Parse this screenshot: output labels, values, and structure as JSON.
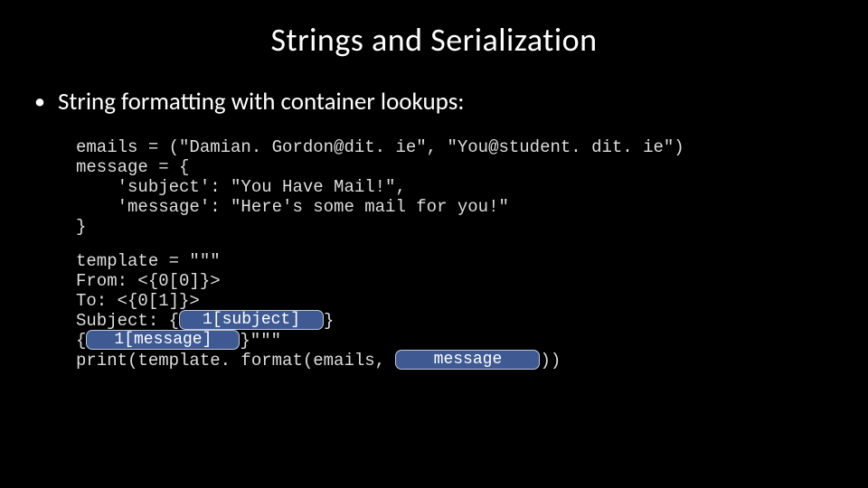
{
  "title": "Strings and Serialization",
  "bullet": "String formatting with container lookups:",
  "code_block1": "emails = (\"Damian. Gordon@dit. ie\", \"You@student. dit. ie\")\nmessage = {\n    'subject': \"You Have Mail!\",\n    'message': \"Here's some mail for you!\"\n}",
  "code2": {
    "l1": "template = \"\"\"",
    "l2": "From: <{0[0]}>",
    "l3": "To: <{0[1]}>",
    "l4_a": "Subject: {",
    "l4_pill": "1[subject]",
    "l4_b": "}",
    "l5_a": "{",
    "l5_pill": "1[message]",
    "l5_b": "}\"\"\"",
    "l6_a": "print(template. format(emails, ",
    "l6_pill": "message",
    "l6_b": "))"
  }
}
